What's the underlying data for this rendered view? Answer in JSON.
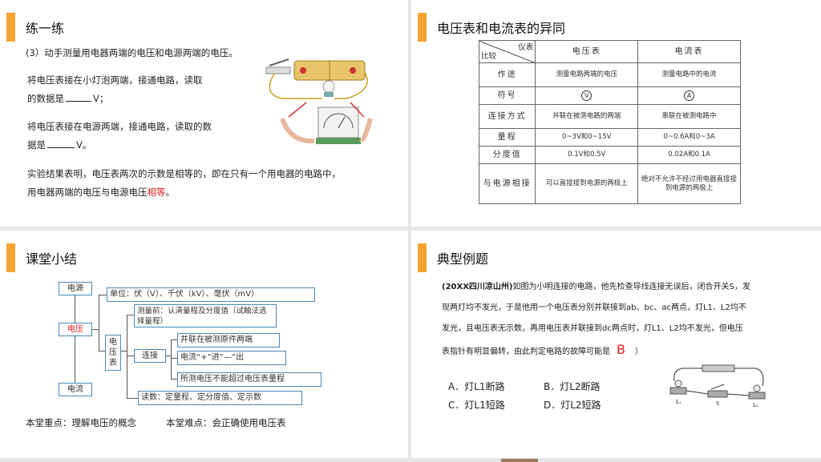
{
  "panel1": {
    "title": "练一练",
    "question": "(3）动手测量用电器两端的电压和电源两端的电压。",
    "step1_line1": "将电压表接在小灯泡两端，接通电路，读取",
    "step1_line2a": "的数据是",
    "step1_line2b": "V；",
    "step2_line1": "将电压表接在电源两端，接通电路，读取的数",
    "step2_line2a": "据是",
    "step2_line2b": "V。",
    "conclusion_line1": "实验结果表明，电压表两次的示数是相等的，即在只有一个用电器的电路中，",
    "conclusion_line2a": "用电器两端的电压与电源电压",
    "conclusion_red": "相等",
    "conclusion_end": "。"
  },
  "panel2": {
    "title": "电压表和电流表的异同",
    "header_top": "仪表",
    "header_bottom": "比较",
    "col1": "电压表",
    "col2": "电流表",
    "rows": [
      {
        "label": "作途",
        "v": "测量电路两端的电压",
        "a": "测量电路中的电流"
      },
      {
        "label": "符号",
        "v": "V",
        "a": "A"
      },
      {
        "label": "连接方式",
        "v": "并联在被测电路的两端",
        "a": "串联在被测电路中"
      },
      {
        "label": "量程",
        "v": "0~3V和0~15V",
        "a": "0~0.6A和0~3A"
      },
      {
        "label": "分度值",
        "v": "0.1V和0.5V",
        "a": "0.02A和0.1A"
      },
      {
        "label": "与电源相接",
        "v": "可以直接接到电源的两极上",
        "a": "绝对不允许不经过用电器直接接到电源的两极上"
      }
    ]
  },
  "panel3": {
    "title": "课堂小结",
    "power": "电源",
    "voltage": "电压",
    "current": "电流",
    "units": "单位：伏（V）、千伏（kV）、毫伏（mV）",
    "meter": "电压表",
    "before": "测量前：认清量程及分度值（试触法选择量程）",
    "connect": "连接",
    "parallel": "并联在被测原件两端",
    "plusminus": "电流“+”进“—”出",
    "range": "所测电压不能超过电压表量程",
    "reading": "读数：定量程、定分度值、定示数",
    "key_point": "本堂重点：理解电压的概念",
    "difficulty": "本堂难点：会正确使用电压表"
  },
  "panel4": {
    "title": "典型例题",
    "source": "(20XX四川凉山州)",
    "q_line1": "如图为小明连接的电路，他先检查导线连接无误后，闭合开关S，发",
    "q_line2": "现两灯均不发光，于是他用一个电压表分别并联接到ab、bc、ac两点，灯L1、L2均不",
    "q_line3": "发光，且电压表无示数，再用电压表并联接到dc两点时，灯L1、L2均不发光，但电压",
    "q_line4": "表指针有明显偏转，由此判定电路的故障可能是",
    "answer": "B",
    "q_end": "）",
    "optA": "A．灯L1断路",
    "optB": "B．灯L2断路",
    "optC": "C．灯L1短路",
    "optD": "D．灯L2短路",
    "label_L1": "L₁",
    "label_S": "S",
    "label_L2": "L₂"
  }
}
